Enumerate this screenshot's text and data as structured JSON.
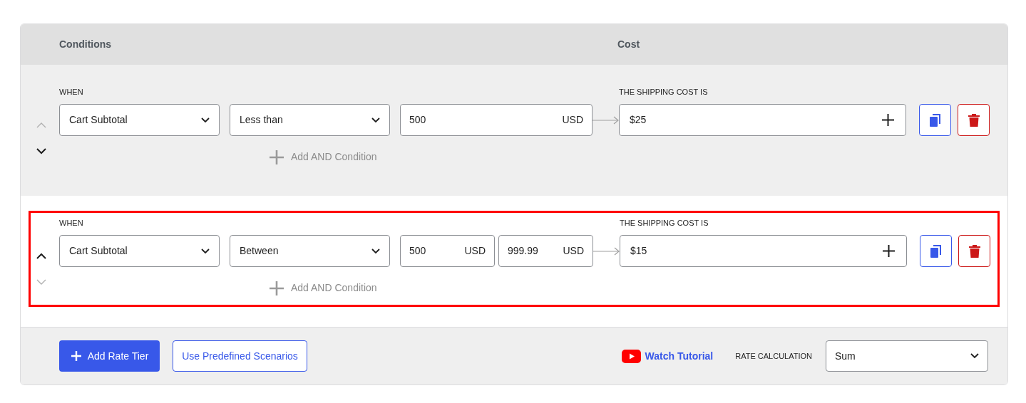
{
  "header": {
    "conditions": "Conditions",
    "cost": "Cost"
  },
  "tiers": [
    {
      "when_label": "WHEN",
      "can_move_up": false,
      "can_move_down": true,
      "highlighted": false,
      "subject": "Cart Subtotal",
      "operator": "Less than",
      "values": [
        {
          "value": "500",
          "unit": "USD"
        }
      ],
      "add_condition": "Add AND Condition",
      "cost_label": "THE SHIPPING COST IS",
      "cost": "$25"
    },
    {
      "when_label": "WHEN",
      "can_move_up": true,
      "can_move_down": false,
      "highlighted": true,
      "subject": "Cart Subtotal",
      "operator": "Between",
      "values": [
        {
          "value": "500",
          "unit": "USD"
        },
        {
          "value": "999.99",
          "unit": "USD"
        }
      ],
      "add_condition": "Add AND Condition",
      "cost_label": "THE SHIPPING COST IS",
      "cost": "$15"
    }
  ],
  "footer": {
    "add_tier": "Add Rate Tier",
    "predefined": "Use Predefined Scenarios",
    "tutorial": "Watch Tutorial",
    "rate_label": "RATE CALCULATION",
    "rate": "Sum"
  }
}
